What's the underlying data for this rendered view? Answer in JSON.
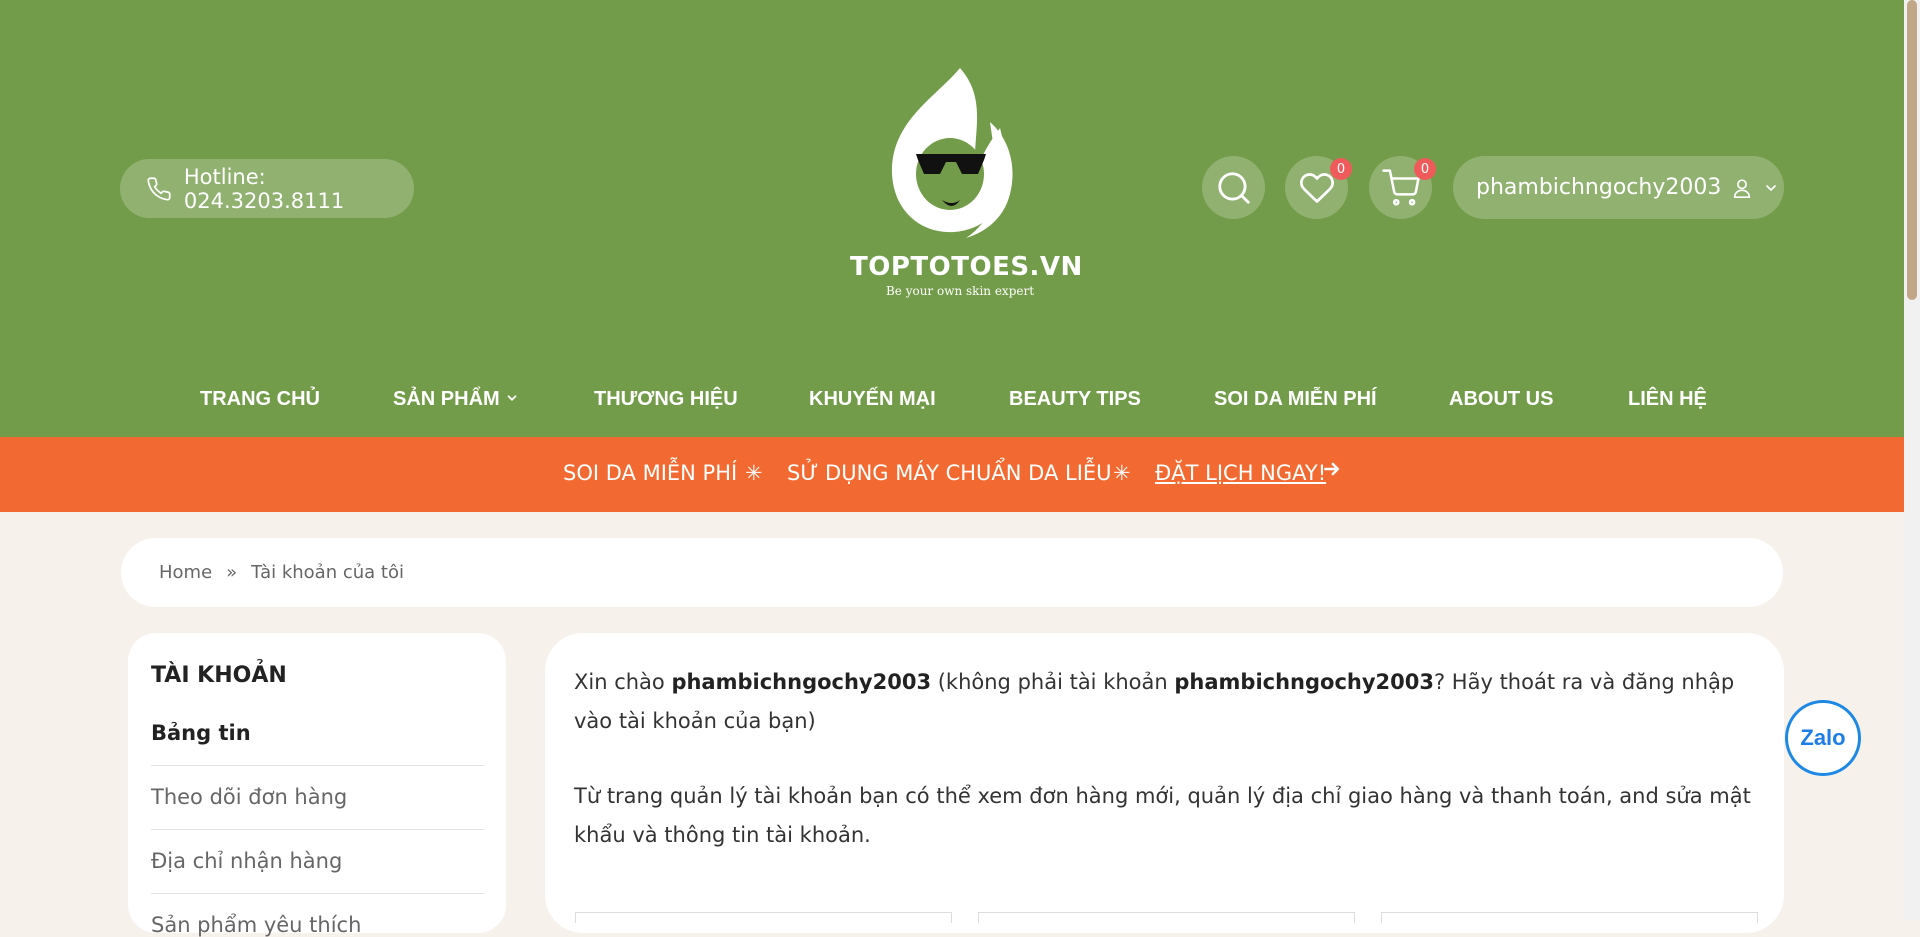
{
  "header": {
    "hotline": "Hotline: 024.3203.8111",
    "brand": "TOPTOTOES.VN",
    "tagline": "Be your own skin expert",
    "wishlist_count": "0",
    "cart_count": "0",
    "username": "phambichngochy2003"
  },
  "nav": {
    "items": [
      "TRANG CHỦ",
      "SẢN PHẨM",
      "THƯƠNG HIỆU",
      "KHUYẾN MẠI",
      "BEAUTY TIPS",
      "SOI DA MIỄN PHÍ",
      "ABOUT US",
      "LIÊN HỆ"
    ]
  },
  "promo": {
    "part1": "SOI DA MIỄN PHÍ",
    "part2": "SỬ DỤNG MÁY CHUẨN DA LIỄU",
    "cta": "ĐẶT LỊCH NGAY!"
  },
  "breadcrumb": {
    "home": "Home",
    "separator": "»",
    "current": "Tài khoản của tôi"
  },
  "sidebar": {
    "title": "TÀI KHOẢN",
    "items": [
      "Bảng tin",
      "Theo dõi đơn hàng",
      "Địa chỉ nhận hàng",
      "Sản phẩm yêu thích"
    ]
  },
  "main": {
    "greet_prefix": "Xin chào ",
    "greet_user": "phambichngochy2003",
    "greet_mid": " (không phải tài khoản ",
    "greet_user2": "phambichngochy2003",
    "greet_suffix": "? Hãy thoát ra và đăng nhập vào tài khoản của bạn)",
    "intro": "Từ trang quản lý tài khoản bạn có thể xem đơn hàng mới, quản lý địa chỉ giao hàng và thanh toán, and sửa mật khẩu và thông tin tài khoản."
  },
  "zalo": {
    "label": "Zalo"
  },
  "colors": {
    "header_green": "#739c4a",
    "promo_orange": "#f26a31",
    "page_bg": "#f7f1ec",
    "badge_red": "#ef5b5b"
  }
}
